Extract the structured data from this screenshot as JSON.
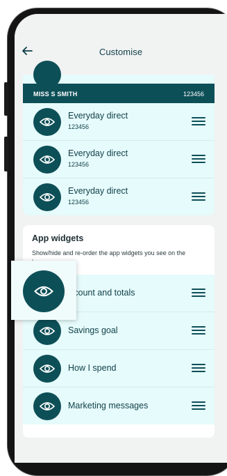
{
  "header": {
    "title": "Customise"
  },
  "account": {
    "name": "MISS S SMITH",
    "number": "123456"
  },
  "accounts": [
    {
      "title": "Everyday direct",
      "subtitle": "123456"
    },
    {
      "title": "Everyday direct",
      "subtitle": "123456"
    },
    {
      "title": "Everyday direct",
      "subtitle": "123456"
    }
  ],
  "widgets": {
    "title": "App widgets",
    "description": "Show/hide and re-order the app widgets you see on the home screen.",
    "items": [
      {
        "label": "Account and totals",
        "visible_text": "ccount and totals"
      },
      {
        "label": "Savings goal"
      },
      {
        "label": "How I spend"
      },
      {
        "label": "Marketing messages"
      }
    ]
  },
  "icons": {
    "toggle": "eye-icon",
    "reorder": "drag-handle-icon",
    "back": "back-arrow-icon"
  },
  "colors": {
    "accent": "#0d4f57",
    "row_bg": "#e6fbfb",
    "screen_bg": "#f1f2f2"
  }
}
